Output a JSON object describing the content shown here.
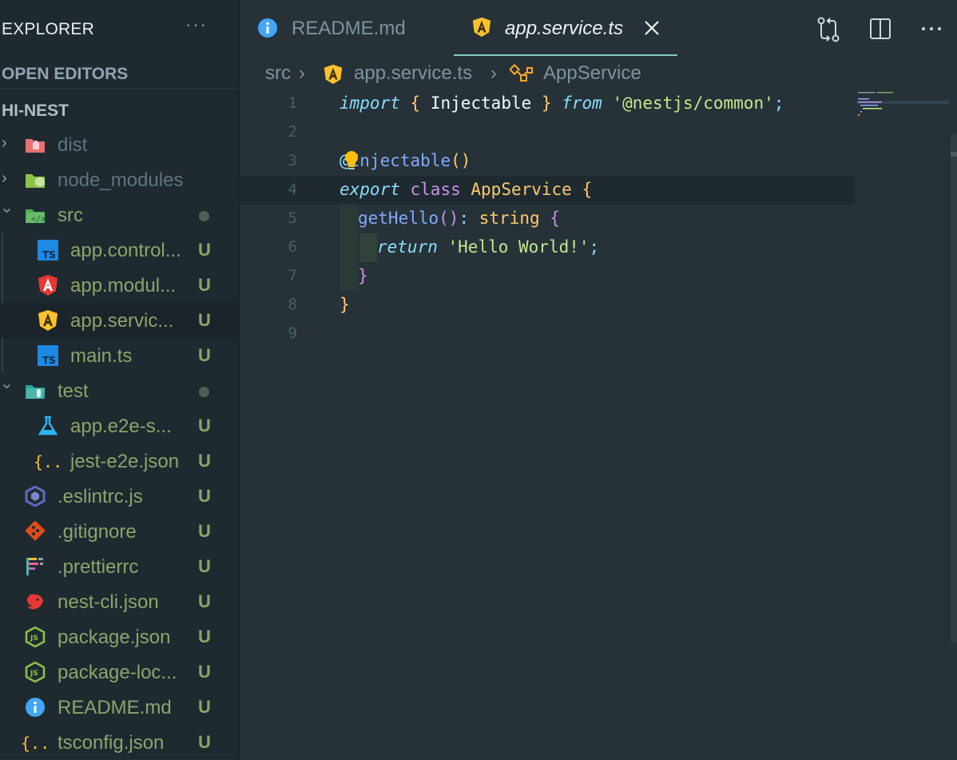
{
  "explorer": {
    "title": "EXPLORER",
    "more": "···",
    "open_editors": "OPEN EDITORS",
    "project": "HI-NEST"
  },
  "tree": [
    {
      "label": "dist",
      "kind": "folder",
      "icon": "folder-dist-icon",
      "expanded": false,
      "badge": ""
    },
    {
      "label": "node_modules",
      "kind": "folder",
      "icon": "folder-node-icon",
      "expanded": false,
      "badge": ""
    },
    {
      "label": "src",
      "kind": "folder",
      "icon": "folder-src-icon",
      "expanded": true,
      "badge": "dot"
    },
    {
      "label": "app.control...",
      "kind": "file",
      "icon": "typescript-icon",
      "badge": "U"
    },
    {
      "label": "app.modul...",
      "kind": "file",
      "icon": "angular-red-icon",
      "badge": "U"
    },
    {
      "label": "app.servic...",
      "kind": "file",
      "icon": "angular-yellow-icon",
      "badge": "U",
      "selected": true
    },
    {
      "label": "main.ts",
      "kind": "file",
      "icon": "typescript-icon",
      "badge": "U"
    },
    {
      "label": "test",
      "kind": "folder",
      "icon": "folder-test-icon",
      "expanded": true,
      "badge": "dot"
    },
    {
      "label": "app.e2e-s...",
      "kind": "file",
      "icon": "flask-icon",
      "badge": "U"
    },
    {
      "label": "jest-e2e.json",
      "kind": "file",
      "icon": "json-braces-icon",
      "badge": "U"
    },
    {
      "label": ".eslintrc.js",
      "kind": "file",
      "icon": "eslint-icon",
      "badge": "U"
    },
    {
      "label": ".gitignore",
      "kind": "file",
      "icon": "git-icon",
      "badge": "U"
    },
    {
      "label": ".prettierrc",
      "kind": "file",
      "icon": "prettier-icon",
      "badge": "U"
    },
    {
      "label": "nest-cli.json",
      "kind": "file",
      "icon": "nest-icon",
      "badge": "U"
    },
    {
      "label": "package.json",
      "kind": "file",
      "icon": "nodejs-icon",
      "badge": "U"
    },
    {
      "label": "package-loc...",
      "kind": "file",
      "icon": "nodejs-icon",
      "badge": "U"
    },
    {
      "label": "README.md",
      "kind": "file",
      "icon": "info-icon",
      "badge": "U"
    },
    {
      "label": "tsconfig.json",
      "kind": "file",
      "icon": "json-braces-icon",
      "badge": "U"
    }
  ],
  "tabs": [
    {
      "label": "README.md",
      "icon": "info-icon",
      "active": false
    },
    {
      "label": "app.service.ts",
      "icon": "angular-yellow-icon",
      "active": true
    }
  ],
  "breadcrumb": {
    "folder": "src",
    "file": "app.service.ts",
    "symbol": "AppService"
  },
  "code": {
    "line_numbers": [
      "1",
      "2",
      "3",
      "4",
      "5",
      "6",
      "7",
      "8",
      "9"
    ],
    "l1": {
      "import": "import",
      "open": "{",
      "name": " Injectable ",
      "close": "}",
      "from": "from",
      "module": "'@nestjs/common'",
      "semi": ";"
    },
    "l3": {
      "at": "@",
      "decorator": "Injectable",
      "parens": "()"
    },
    "l4": {
      "export": "export",
      "class": "class",
      "name": "AppService",
      "brace": "{"
    },
    "l5": {
      "method": "getHello",
      "parens": "()",
      "colon": ":",
      "type": "string",
      "brace": "{"
    },
    "l6": {
      "return": "return",
      "str": "'Hello World!'",
      "semi": ";"
    },
    "l7": {
      "brace": "}"
    },
    "l8": {
      "brace": "}"
    }
  },
  "colors": {
    "background": "#263238",
    "sidebar": "#1e2a30",
    "accent": "#80cbc4",
    "untracked": "#8fa36a"
  }
}
